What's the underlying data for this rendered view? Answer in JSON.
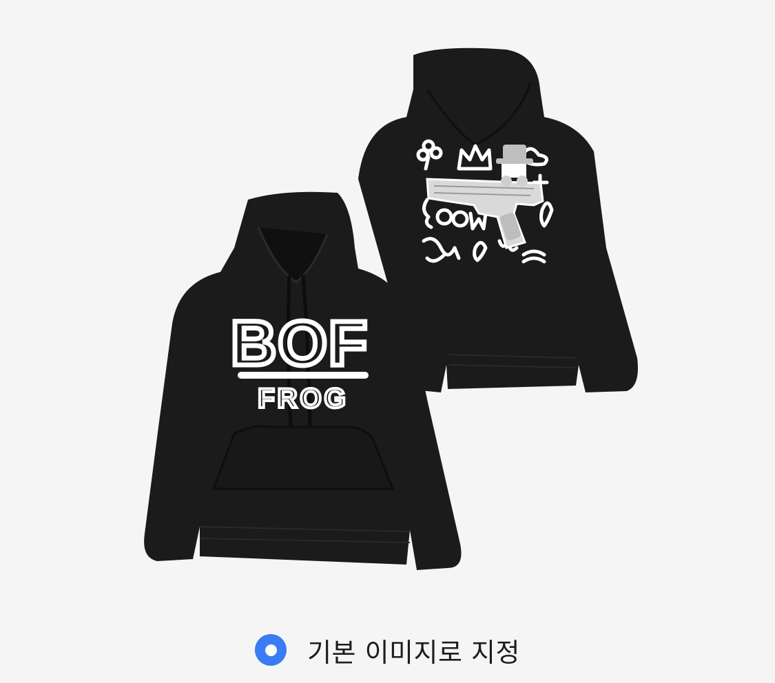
{
  "product": {
    "front_print_top": "BOF",
    "front_print_bottom": "FROG",
    "back_print_words": [
      "BOOM"
    ],
    "garment_color": "#1b1b1b",
    "print_color": "#ffffff"
  },
  "default_image_option": {
    "label": "기본 이미지로 지정",
    "selected": true,
    "accent_color": "#3b7bf3"
  }
}
